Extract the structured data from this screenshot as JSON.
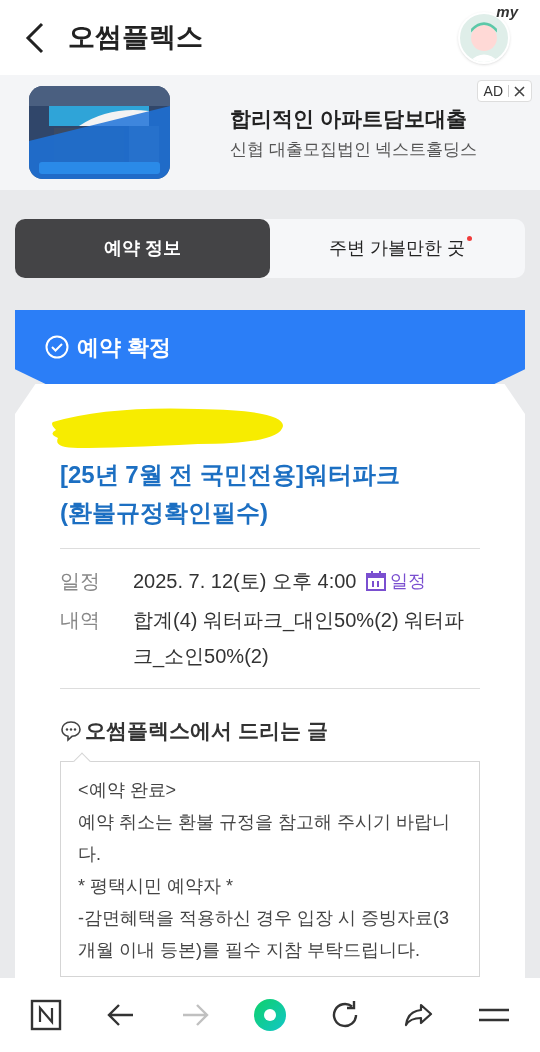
{
  "header": {
    "title": "오썸플렉스",
    "avatar_label": "my"
  },
  "ad": {
    "badge": "AD",
    "title": "합리적인 아파트담보대출",
    "subtitle": "신협 대출모집법인 넥스트홀딩스"
  },
  "tabs": [
    {
      "label": "예약 정보",
      "selected": true,
      "new_dot": false
    },
    {
      "label": "주변 가볼만한 곳",
      "selected": false,
      "new_dot": true
    }
  ],
  "status_banner": {
    "label": "예약 확정"
  },
  "booking": {
    "title_lines": [
      "[25년 7월 전 국민전용]워터파크",
      "(환불규정확인필수)"
    ],
    "details": [
      {
        "label": "일정",
        "value": "2025. 7. 12(토) 오후 4:00",
        "link": "일정"
      },
      {
        "label": "내역",
        "value": "합계(4) 워터파크_대인50%(2) 워터파크_소인50%(2)"
      }
    ]
  },
  "message": {
    "heading": "오썸플렉스에서 드리는 글",
    "paragraphs": [
      "<예약 완료>",
      "예약 취소는 환불 규정을 참고해 주시기 바랍니다.",
      "* 평택시민 예약자 *",
      "-감면혜택을 적용하신 경우 입장 시 증빙자료(3개월 이내 등본)를 필수 지참 부탁드립니다."
    ]
  },
  "nav": [
    {
      "kind": "naver",
      "disabled": false
    },
    {
      "kind": "back",
      "disabled": false
    },
    {
      "kind": "forward",
      "disabled": true
    },
    {
      "kind": "home",
      "disabled": false
    },
    {
      "kind": "reload",
      "disabled": false
    },
    {
      "kind": "share",
      "disabled": false
    },
    {
      "kind": "menu",
      "disabled": false
    }
  ]
}
